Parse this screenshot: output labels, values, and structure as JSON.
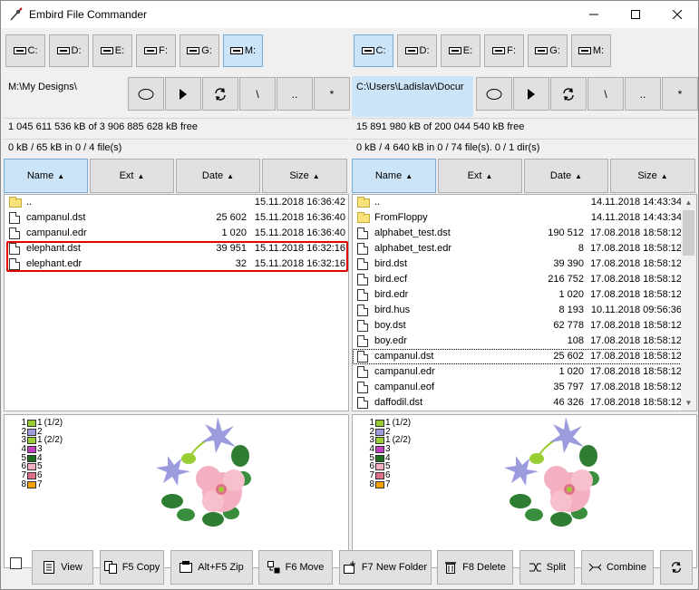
{
  "window": {
    "title": "Embird File Commander"
  },
  "left": {
    "drives": [
      "C:",
      "D:",
      "E:",
      "F:",
      "G:",
      "M:"
    ],
    "active_drive": 5,
    "path": "M:\\My Designs\\",
    "path_actions": [
      "backslash",
      "up",
      "asterisk"
    ],
    "path_action_labels": {
      "backslash": "\\",
      "up": "..",
      "asterisk": "*"
    },
    "free_info": "1 045 611 536 kB of 3 906 885 628 kB free",
    "selection_info": "0 kB / 65 kB in 0 / 4 file(s)",
    "columns": {
      "name": "Name",
      "ext": "Ext",
      "date": "Date",
      "size": "Size"
    },
    "files": [
      {
        "icon": "folder",
        "name": "..",
        "size": "",
        "date": "15.11.2018 16:36:42"
      },
      {
        "icon": "doc",
        "name": "campanul.dst",
        "size": "25 602",
        "date": "15.11.2018 16:36:40"
      },
      {
        "icon": "doc",
        "name": "campanul.edr",
        "size": "1 020",
        "date": "15.11.2018 16:36:40"
      },
      {
        "icon": "doc",
        "name": "elephant.dst",
        "size": "39 951",
        "date": "15.11.2018 16:32:16"
      },
      {
        "icon": "doc",
        "name": "elephant.edr",
        "size": "32",
        "date": "15.11.2018 16:32:16"
      }
    ],
    "legend": [
      {
        "num": "1",
        "color": "#9acd32",
        "num2": "1",
        "label": "(1/2)"
      },
      {
        "num": "2",
        "color": "#9b9bde",
        "num2": "2",
        "label": ""
      },
      {
        "num": "3",
        "color": "#9acd32",
        "num2": "1",
        "label": "(2/2)"
      },
      {
        "num": "4",
        "color": "#c040c0",
        "num2": "3",
        "label": ""
      },
      {
        "num": "5",
        "color": "#1f6e1f",
        "num2": "4",
        "label": ""
      },
      {
        "num": "6",
        "color": "#f4b0c0",
        "num2": "5",
        "label": ""
      },
      {
        "num": "7",
        "color": "#e0708a",
        "num2": "6",
        "label": ""
      },
      {
        "num": "8",
        "color": "#f4a000",
        "num2": "7",
        "label": ""
      }
    ]
  },
  "right": {
    "drives": [
      "C:",
      "D:",
      "E:",
      "F:",
      "G:",
      "M:"
    ],
    "active_drive": 0,
    "path": "C:\\Users\\Ladislav\\Docur",
    "path_action_labels": {
      "backslash": "\\",
      "up": "..",
      "asterisk": "*"
    },
    "free_info": "15 891 980 kB of 200 044 540 kB free",
    "selection_info": "0 kB / 4 640 kB in 0 / 74 file(s). 0 / 1 dir(s)",
    "columns": {
      "name": "Name",
      "ext": "Ext",
      "date": "Date",
      "size": "Size"
    },
    "files": [
      {
        "icon": "folder",
        "name": "..",
        "size": "",
        "date": "14.11.2018 14:43:34"
      },
      {
        "icon": "folder",
        "name": "FromFloppy",
        "size": "",
        "date": "14.11.2018 14:43:34"
      },
      {
        "icon": "doc",
        "name": "alphabet_test.dst",
        "size": "190 512",
        "date": "17.08.2018 18:58:12"
      },
      {
        "icon": "doc",
        "name": "alphabet_test.edr",
        "size": "8",
        "date": "17.08.2018 18:58:12"
      },
      {
        "icon": "doc",
        "name": "bird.dst",
        "size": "39 390",
        "date": "17.08.2018 18:58:12"
      },
      {
        "icon": "doc",
        "name": "bird.ecf",
        "size": "216 752",
        "date": "17.08.2018 18:58:12"
      },
      {
        "icon": "doc",
        "name": "bird.edr",
        "size": "1 020",
        "date": "17.08.2018 18:58:12"
      },
      {
        "icon": "doc",
        "name": "bird.hus",
        "size": "8 193",
        "date": "10.11.2018 09:56:36"
      },
      {
        "icon": "doc",
        "name": "boy.dst",
        "size": "62 778",
        "date": "17.08.2018 18:58:12"
      },
      {
        "icon": "doc",
        "name": "boy.edr",
        "size": "108",
        "date": "17.08.2018 18:58:12"
      },
      {
        "icon": "doc",
        "name": "campanul.dst",
        "size": "25 602",
        "date": "17.08.2018 18:58:12"
      },
      {
        "icon": "doc",
        "name": "campanul.edr",
        "size": "1 020",
        "date": "17.08.2018 18:58:12"
      },
      {
        "icon": "doc",
        "name": "campanul.eof",
        "size": "35 797",
        "date": "17.08.2018 18:58:12"
      },
      {
        "icon": "doc",
        "name": "daffodil.dst",
        "size": "46 326",
        "date": "17.08.2018 18:58:12"
      }
    ],
    "focused_row": 10,
    "legend": [
      {
        "num": "1",
        "color": "#9acd32",
        "num2": "1",
        "label": "(1/2)"
      },
      {
        "num": "2",
        "color": "#9b9bde",
        "num2": "2",
        "label": ""
      },
      {
        "num": "3",
        "color": "#9acd32",
        "num2": "1",
        "label": "(2/2)"
      },
      {
        "num": "4",
        "color": "#c040c0",
        "num2": "3",
        "label": ""
      },
      {
        "num": "5",
        "color": "#1f6e1f",
        "num2": "4",
        "label": ""
      },
      {
        "num": "6",
        "color": "#f4b0c0",
        "num2": "5",
        "label": ""
      },
      {
        "num": "7",
        "color": "#e0708a",
        "num2": "6",
        "label": ""
      },
      {
        "num": "8",
        "color": "#f4a000",
        "num2": "7",
        "label": ""
      }
    ]
  },
  "toolbar": {
    "view": "View",
    "copy": "F5 Copy",
    "zip": "Alt+F5 Zip",
    "move": "F6 Move",
    "new_folder": "F7 New Folder",
    "delete": "F8 Delete",
    "split": "Split",
    "combine": "Combine"
  },
  "colors": {
    "accent": "#cce4f7",
    "highlight": "#e00000"
  }
}
